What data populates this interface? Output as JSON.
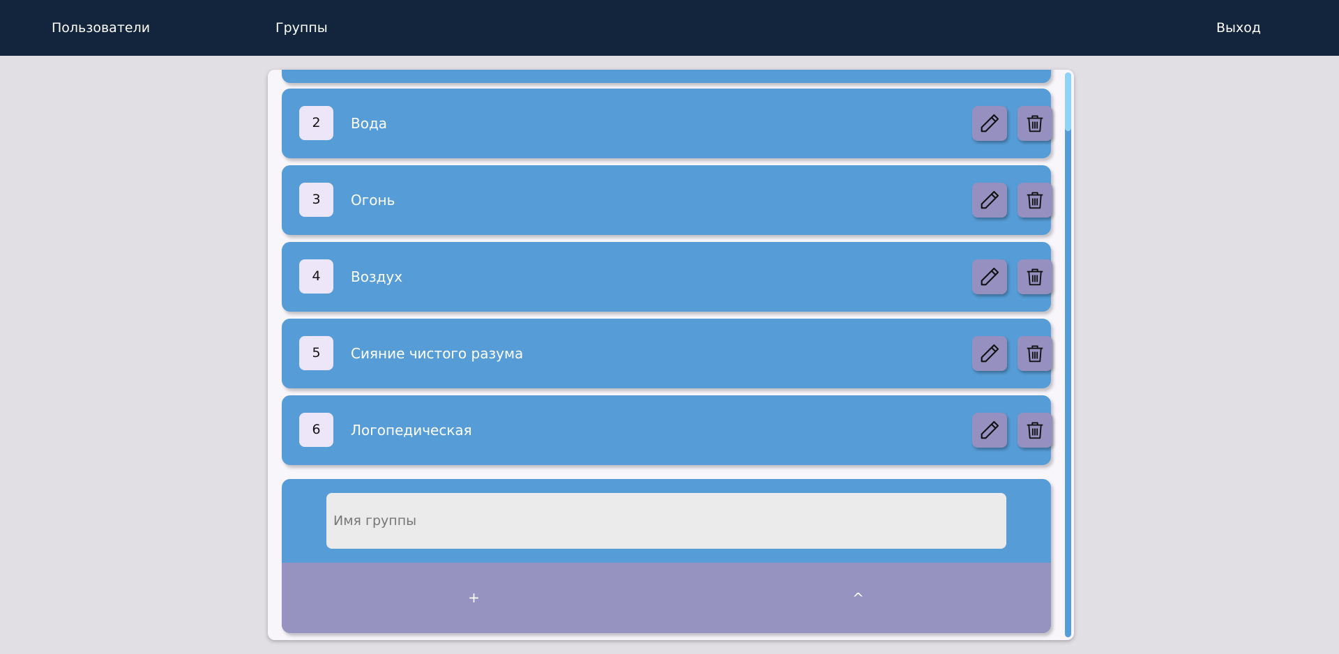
{
  "nav": {
    "users": "Пользователи",
    "groups": "Группы",
    "logout": "Выход"
  },
  "groups": [
    {
      "id": "",
      "name": ""
    },
    {
      "id": "2",
      "name": "Вода"
    },
    {
      "id": "3",
      "name": "Огонь"
    },
    {
      "id": "4",
      "name": "Воздух"
    },
    {
      "id": "5",
      "name": "Сияние чистого разума"
    },
    {
      "id": "6",
      "name": "Логопедическая"
    }
  ],
  "form": {
    "name_placeholder": "Имя группы",
    "add_label": "+",
    "up_label": "^"
  },
  "colors": {
    "header_bg": "#12253c",
    "page_bg": "#e1dee4",
    "row_bg": "#569dd7",
    "button_bg": "#9690c0",
    "badge_bg": "#ece6f8"
  },
  "icons": {
    "edit": "pencil-icon",
    "delete": "trash-icon"
  }
}
